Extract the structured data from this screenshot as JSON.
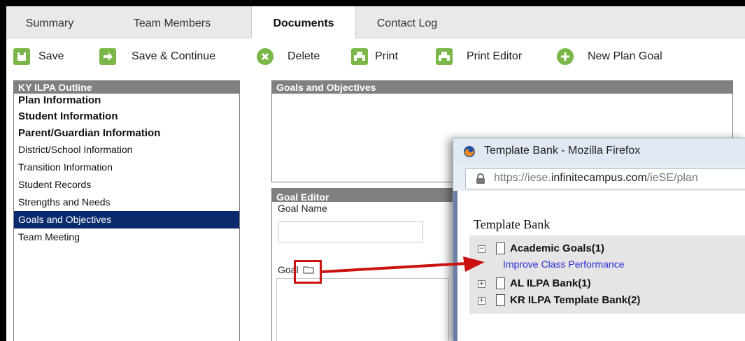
{
  "tabs": [
    {
      "label": "Summary"
    },
    {
      "label": "Team Members"
    },
    {
      "label": "Documents"
    },
    {
      "label": "Contact Log"
    }
  ],
  "toolbar": {
    "save": "Save",
    "save_continue": "Save & Continue",
    "delete": "Delete",
    "print": "Print",
    "print_editor": "Print Editor",
    "new_plan_goal": "New Plan Goal"
  },
  "outline": {
    "title": "KY ILPA Outline",
    "items": [
      {
        "label": "Plan Information"
      },
      {
        "label": "Student Information"
      },
      {
        "label": "Parent/Guardian Information"
      },
      {
        "label": "District/School Information"
      },
      {
        "label": "Transition Information"
      },
      {
        "label": "Student Records"
      },
      {
        "label": "Strengths and Needs"
      },
      {
        "label": "Goals and Objectives"
      },
      {
        "label": "Team Meeting"
      }
    ],
    "selected": "Goals and Objectives"
  },
  "goals_objectives": {
    "title": "Goals and Objectives"
  },
  "goal_editor": {
    "title": "Goal Editor",
    "goal_name_label": "Goal Name",
    "goal_name_value": "",
    "goal_label": "Goal",
    "goal_value": ""
  },
  "popup": {
    "window_title": "Template Bank - Mozilla Firefox",
    "url_prefix": "https://iese.",
    "url_domain": "infinitecampus.com",
    "url_suffix": "/ieSE/plan",
    "heading": "Template Bank",
    "tree": [
      {
        "label": "Academic Goals(1)",
        "expander": "−"
      },
      {
        "label": "Improve Class Performance"
      },
      {
        "label": "AL ILPA Bank(1)",
        "expander": "+"
      },
      {
        "label": "KR ILPA Template Bank(2)",
        "expander": "+"
      }
    ]
  },
  "colors": {
    "accent_green": "#7ab648",
    "selected_nav": "#0b2a6e",
    "panel_header": "#808080",
    "callout_red": "#cc1111",
    "link_blue": "#2a2ad8"
  }
}
